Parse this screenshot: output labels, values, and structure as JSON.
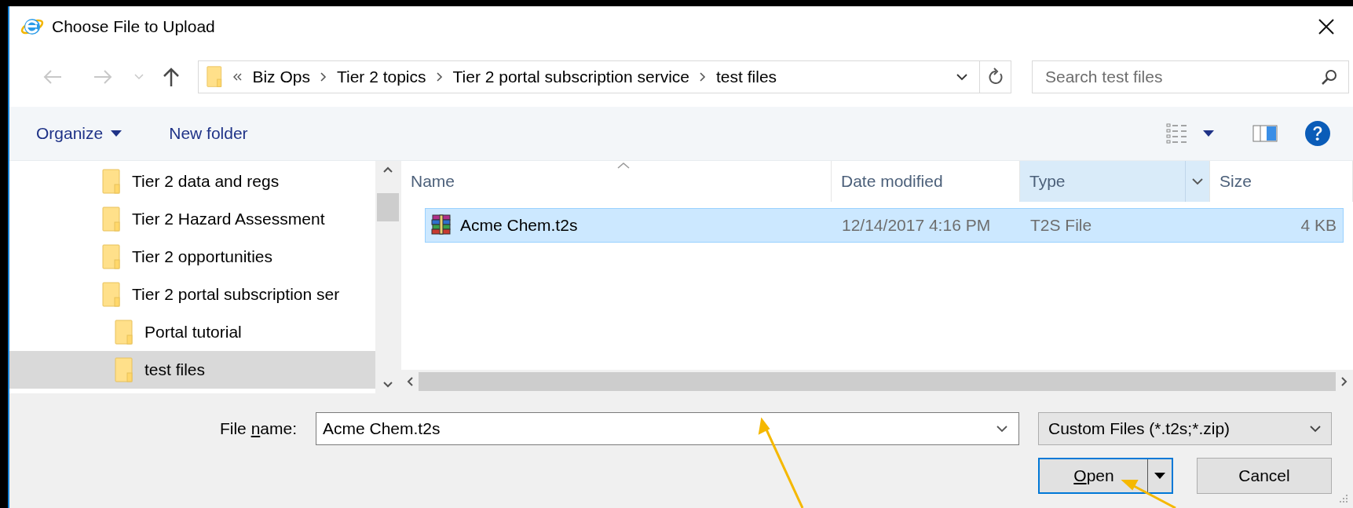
{
  "window": {
    "title": "Choose File to Upload"
  },
  "nav_buttons": [
    {
      "kind": "back",
      "disabled": true
    },
    {
      "kind": "forward",
      "disabled": true
    },
    {
      "kind": "recent",
      "disabled": true
    },
    {
      "kind": "up",
      "disabled": false
    }
  ],
  "address_bar": {
    "path": [
      "Biz Ops",
      "Tier 2 topics",
      "Tier 2 portal subscription service",
      "test files"
    ]
  },
  "search": {
    "placeholder": "Search test files"
  },
  "toolbar": {
    "buttons": [
      {
        "label": "Organize",
        "kind": "menu"
      },
      {
        "label": "New folder",
        "kind": "plain"
      }
    ]
  },
  "tree": {
    "items": [
      {
        "label": "Tier 2 data and regs",
        "selected": false
      },
      {
        "label": "Tier 2 Hazard Assessment",
        "selected": false
      },
      {
        "label": "Tier 2 opportunities",
        "selected": false
      },
      {
        "label": "Tier 2 portal subscription ser",
        "selected": false,
        "children": [
          {
            "label": "Portal tutorial",
            "selected": false
          },
          {
            "label": "test files",
            "selected": true
          }
        ]
      }
    ]
  },
  "file_list": {
    "columns": [
      {
        "label": "Name",
        "sorted": true,
        "highlighted": false
      },
      {
        "label": "Date modified",
        "sorted": false,
        "highlighted": false
      },
      {
        "label": "Type",
        "sorted": false,
        "highlighted": true
      },
      {
        "label": "Size",
        "sorted": false,
        "highlighted": false
      }
    ],
    "rows": [
      {
        "name": "Acme Chem.t2s",
        "date_modified": "12/14/2017 4:16 PM",
        "type": "T2S File",
        "size": "4 KB",
        "selected": true
      }
    ]
  },
  "file_name": {
    "label": [
      {
        "text": "File ",
        "underlined": false
      },
      {
        "text": "n",
        "underlined": true
      },
      {
        "text": "ame:",
        "underlined": false
      }
    ],
    "value": "Acme Chem.t2s"
  },
  "file_type": {
    "value": "Custom Files (*.t2s;*.zip)"
  },
  "buttons": [
    {
      "label": [
        {
          "text": "O",
          "underlined": true
        },
        {
          "text": "pen",
          "underlined": false
        }
      ],
      "kind": "split",
      "default": true
    },
    {
      "label": [
        {
          "text": "Cancel",
          "underlined": false
        }
      ],
      "kind": "plain",
      "default": false
    }
  ]
}
